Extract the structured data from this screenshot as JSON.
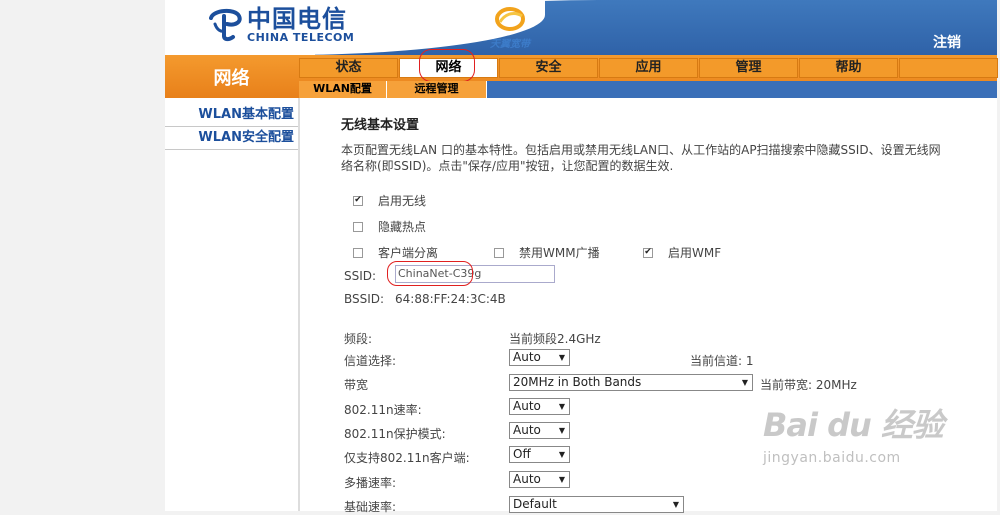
{
  "header": {
    "logo_cn": "中国电信",
    "logo_en": "CHINA TELECOM",
    "tianyi_text": "天翼宽带",
    "logout_label": "注销"
  },
  "nav": {
    "section_title": "网络",
    "main_tabs": [
      {
        "label": "状态"
      },
      {
        "label": "网络",
        "active": true
      },
      {
        "label": "安全"
      },
      {
        "label": "应用"
      },
      {
        "label": "管理"
      },
      {
        "label": "帮助"
      }
    ],
    "sub_tabs": [
      {
        "label": "WLAN配置"
      },
      {
        "label": "远程管理"
      }
    ]
  },
  "sidebar": {
    "items": [
      {
        "label": "WLAN基本配置"
      },
      {
        "label": "WLAN安全配置"
      }
    ]
  },
  "main": {
    "title": "无线基本设置",
    "description": "本页配置无线LAN 口的基本特性。包括启用或禁用无线LAN口、从工作站的AP扫描搜索中隐藏SSID、设置无线网络名称(即SSID)。点击\"保存/应用\"按钮，让您配置的数据生效.",
    "checkboxes": {
      "enable_wireless": {
        "label": "启用无线",
        "checked": true
      },
      "hide_ap": {
        "label": "隐藏热点",
        "checked": false
      },
      "client_isolation": {
        "label": "客户端分离",
        "checked": false
      },
      "disable_wmm_broadcast": {
        "label": "禁用WMM广播",
        "checked": false
      },
      "enable_wmf": {
        "label": "启用WMF",
        "checked": true
      }
    },
    "ssid": {
      "label": "SSID:",
      "value": "ChinaNet-C39g"
    },
    "bssid": {
      "label": "BSSID:",
      "value": "64:88:FF:24:3C:4B"
    },
    "band": {
      "label": "频段:",
      "value": "当前频段2.4GHz"
    },
    "channel": {
      "label": "信道选择:",
      "selected": "Auto",
      "current_label": "当前信道: 1"
    },
    "bandwidth": {
      "label": "带宽",
      "selected": "20MHz in Both Bands",
      "current_label": "当前带宽: 20MHz"
    },
    "rate_11n": {
      "label": "802.11n速率:",
      "selected": "Auto"
    },
    "protection_11n": {
      "label": "802.11n保护模式:",
      "selected": "Auto"
    },
    "only_11n": {
      "label": "仅支持802.11n客户端:",
      "selected": "Off"
    },
    "multicast_rate": {
      "label": "多播速率:",
      "selected": "Auto"
    },
    "basic_rate": {
      "label": "基础速率:",
      "selected": "Default"
    }
  },
  "watermark": {
    "main": "Bai du 经验",
    "sub": "jingyan.baidu.com"
  },
  "colors": {
    "header_blue": "#2f62a8",
    "nav_orange": "#e8801a",
    "annotation_red": "#e02020"
  }
}
